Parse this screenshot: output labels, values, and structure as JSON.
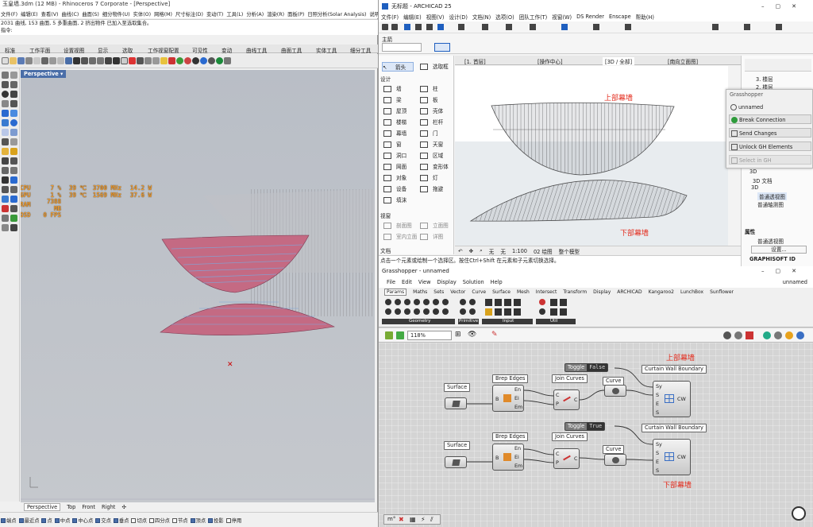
{
  "rhino": {
    "title": "玉皇墙.3dm (12 MB) - Rhinoceros 7 Corporate - [Perspective]",
    "menu": [
      "文件(F)",
      "编辑(E)",
      "查看(V)",
      "曲线(C)",
      "曲面(S)",
      "细分物件(U)",
      "实体(O)",
      "网格(M)",
      "尺寸标注(D)",
      "变动(T)",
      "工具(L)",
      "分析(A)",
      "渲染(R)",
      "面板(P)",
      "日照分析(Solar Analysis)",
      "说明(H)"
    ],
    "history": [
      "2031 曲线, 153 曲面, 5 多重曲面, 2 挤出物件 已加入至选取集合。",
      "指令:"
    ],
    "tabs": [
      "标准",
      "工作平面",
      "设置视图",
      "显示",
      "选取",
      "工作视窗配置",
      "可见性",
      "变动",
      "曲线工具",
      "曲面工具",
      "实体工具",
      "细分工具"
    ],
    "viewport_name": "Perspective",
    "stats": [
      {
        "label": "CPU",
        "pct": "7 %",
        "temp": "39 ℃",
        "clock": "3700 MHz",
        "w": "14.2 W"
      },
      {
        "label": "GPU",
        "pct": "1 %",
        "temp": "39 ℃",
        "clock": "1569 MHz",
        "w": "37.6 W"
      },
      {
        "label": "RAM",
        "val": "7388 MB"
      },
      {
        "label": "OSD",
        "val": "0 FPS"
      }
    ],
    "viewport_tabs": [
      "Perspective",
      "Top",
      "Front",
      "Right"
    ],
    "osnaps": [
      "端点",
      "最近点",
      "点",
      "中点",
      "中心点",
      "交点",
      "垂点",
      "切点",
      "四分点",
      "节点",
      "顶点",
      "投影",
      "停用"
    ],
    "osnaps_checked": [
      true,
      true,
      true,
      true,
      true,
      true,
      true,
      false,
      false,
      false,
      true,
      true,
      false
    ]
  },
  "archicad": {
    "title": "无标题 - ARCHICAD 25",
    "menu": [
      "文件(F)",
      "编辑(E)",
      "视图(V)",
      "设计(D)",
      "文档(N)",
      "选项(O)",
      "团队工作(T)",
      "视窗(W)",
      "DS Render",
      "Enscape",
      "帮助(H)"
    ],
    "toolbox_header": "主箭",
    "tool_top": [
      "箭头",
      "选取框"
    ],
    "section_design": "设计",
    "tools_left": [
      "墙",
      "梁",
      "屋顶",
      "楼梯",
      "幕墙",
      "窗",
      "洞口",
      "网面",
      "对象",
      "设备",
      "填沫"
    ],
    "tools_right": [
      "柱",
      "板",
      "壳体",
      "栏杆",
      "门",
      "天窗",
      "区域",
      "变形体",
      "灯",
      "拖避"
    ],
    "section_view": "视窗",
    "view_tools_left": [
      "剖面图",
      "室内立面",
      "..."
    ],
    "view_tools_right": [
      "立面图",
      "详图"
    ],
    "section_doc": "文档",
    "view_tabs": [
      "[1. 首层]",
      "[操作中心]",
      "[3D / 全部]",
      "[南向立面图]"
    ],
    "label_top": "上部幕墙",
    "label_bottom": "下部幕墙",
    "bottom_bar": [
      "无",
      "无",
      "1:100",
      "02 绘图",
      "整个模型"
    ],
    "status": "点击一个元素或绘制一个选择区。按住Ctrl+Shift 在元素和子元素切换选择。",
    "nav": [
      "3. 楼层",
      "2. 楼层",
      "3D",
      "3D 文档",
      "3D",
      "普通透视图",
      "普通轴测图"
    ],
    "nav_props": "属性",
    "nav_prop_item": "普通透视图",
    "nav_settings": "设置...",
    "brand": "GRAPHISOFT ID",
    "gh_popup": {
      "title": "Grasshopper",
      "items": [
        "unnamed",
        "Break Connection",
        "Send Changes",
        "Unlock GH Elements",
        "Select in GH"
      ]
    }
  },
  "grasshopper": {
    "title": "Grasshopper - unnamed",
    "doc_name": "unnamed",
    "menu": [
      "File",
      "Edit",
      "View",
      "Display",
      "Solution",
      "Help"
    ],
    "tabs": [
      "Params",
      "Maths",
      "Sets",
      "Vector",
      "Curve",
      "Surface",
      "Mesh",
      "Intersect",
      "Transform",
      "Display",
      "ARCHICAD",
      "Kangaroo2",
      "LunchBox",
      "Sunflower"
    ],
    "ribbon_groups": [
      "Geometry",
      "Primitive",
      "Input",
      "Util"
    ],
    "zoom": "118%",
    "label_top": "上部幕墙",
    "label_bottom": "下部幕墙",
    "toggle_label": "Toggle",
    "toggle_top": "False",
    "toggle_bottom": "True",
    "surface": "Surface",
    "brep_edges": "Brep Edges",
    "brep_ports_in": "B",
    "brep_ports_out": [
      "En",
      "Ei",
      "Em"
    ],
    "join_curves": "Join Curves",
    "join_ports_in": [
      "C",
      "P"
    ],
    "join_ports_out": "C",
    "curve": "Curve",
    "cw_boundary": "Curtain Wall Boundary",
    "cw_ports_in": [
      "Sy",
      "S",
      "E",
      "S"
    ],
    "cw_out": "CW"
  },
  "colors": {
    "curtain_pink": "#c46a83",
    "curtain_blue": "#7fa6d9",
    "accent": "#4a6ea8",
    "red_label": "#e32b1c"
  }
}
